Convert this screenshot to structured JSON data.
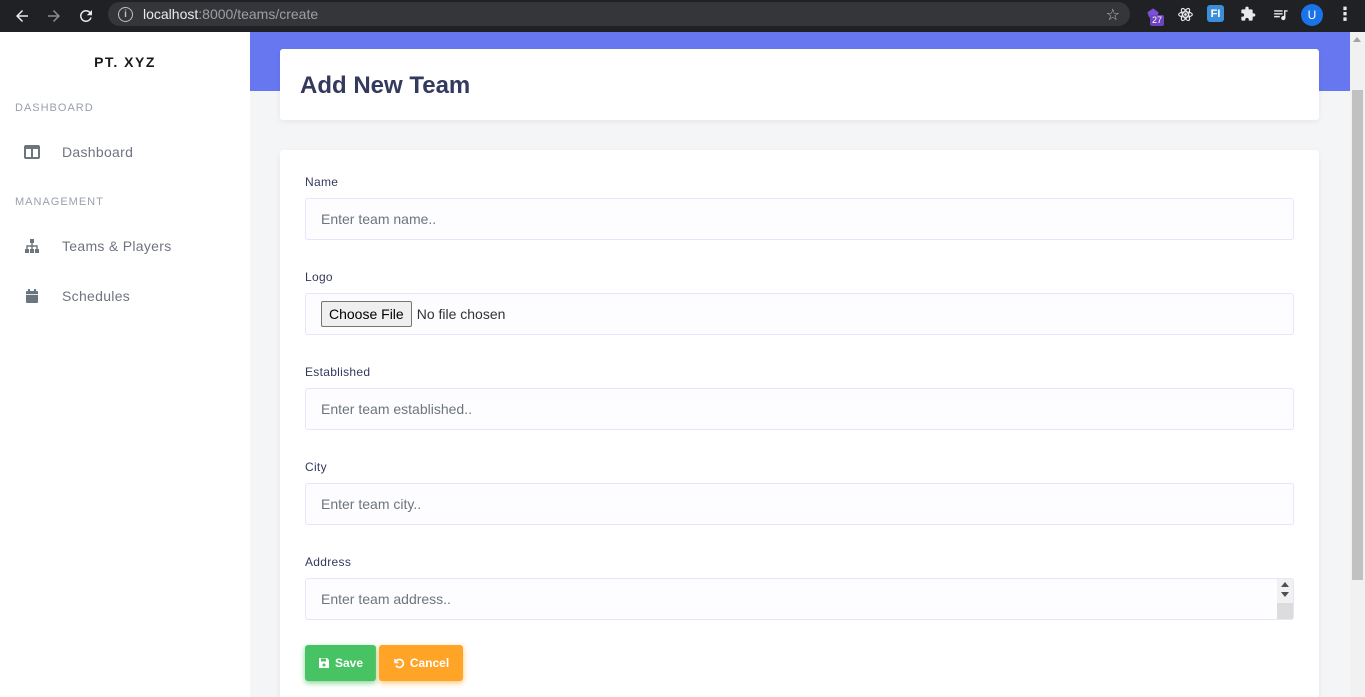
{
  "browser": {
    "url_host": "localhost",
    "url_rest": ":8000/teams/create",
    "extension_badge": "27",
    "ext_fi_label": "FI",
    "avatar_letter": "U"
  },
  "sidebar": {
    "brand": "PT. XYZ",
    "sections": [
      {
        "title": "DASHBOARD",
        "items": [
          {
            "label": "Dashboard",
            "icon": "columns-icon"
          }
        ]
      },
      {
        "title": "MANAGEMENT",
        "items": [
          {
            "label": "Teams & Players",
            "icon": "sitemap-icon"
          },
          {
            "label": "Schedules",
            "icon": "calendar-icon"
          }
        ]
      }
    ]
  },
  "page": {
    "title": "Add New Team"
  },
  "form": {
    "name": {
      "label": "Name",
      "placeholder": "Enter team name.."
    },
    "logo": {
      "label": "Logo",
      "button": "Choose File",
      "status": "No file chosen"
    },
    "established": {
      "label": "Established",
      "placeholder": "Enter team established.."
    },
    "city": {
      "label": "City",
      "placeholder": "Enter team city.."
    },
    "address": {
      "label": "Address",
      "placeholder": "Enter team address.."
    },
    "save_label": "Save",
    "cancel_label": "Cancel"
  },
  "colors": {
    "primary": "#6777ef",
    "success": "#47c363",
    "warning": "#ffa426",
    "heading": "#34395e"
  }
}
